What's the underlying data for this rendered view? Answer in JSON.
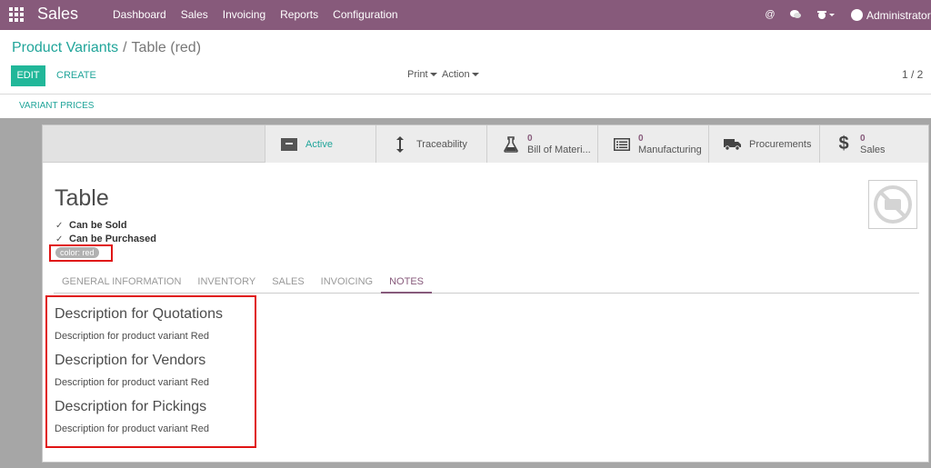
{
  "navbar": {
    "brand": "Sales",
    "menu": [
      "Dashboard",
      "Sales",
      "Invoicing",
      "Reports",
      "Configuration"
    ],
    "user": "Administrator ("
  },
  "breadcrumb": {
    "parent": "Product Variants",
    "separator": "/",
    "current": "Table (red)"
  },
  "toolbar": {
    "edit_label": "EDIT",
    "create_label": "CREATE",
    "print_label": "Print",
    "action_label": "Action",
    "pager": "1 / 2",
    "variant_prices_label": "VARIANT PRICES"
  },
  "smart_buttons": [
    {
      "icon": "archive-icon",
      "label": "Active",
      "count": ""
    },
    {
      "icon": "arrows-vertical-icon",
      "label": "Traceability",
      "count": ""
    },
    {
      "icon": "flask-icon",
      "label": "Bill of Materi...",
      "count": "0"
    },
    {
      "icon": "list-icon",
      "label": "Manufacturing",
      "count": "0"
    },
    {
      "icon": "truck-icon",
      "label": "Procurements",
      "count": ""
    },
    {
      "icon": "dollar-icon",
      "label": "Sales",
      "count": "0"
    }
  ],
  "product": {
    "name": "Table",
    "can_be_sold": "Can be Sold",
    "can_be_purchased": "Can be Purchased",
    "attribute_tag": "color: red"
  },
  "tabs": [
    "GENERAL INFORMATION",
    "INVENTORY",
    "SALES",
    "INVOICING",
    "NOTES"
  ],
  "active_tab": "NOTES",
  "notes": [
    {
      "heading": "Description for Quotations",
      "text": "Description for  product variant Red"
    },
    {
      "heading": "Description for Vendors",
      "text": "Description for  product variant Red"
    },
    {
      "heading": "Description for Pickings",
      "text": "Description for  product variant Red"
    }
  ],
  "colors": {
    "navbar": "#875a7b",
    "accent": "#21a59a",
    "edit_button": "#21b799",
    "highlight": "#e01414"
  }
}
